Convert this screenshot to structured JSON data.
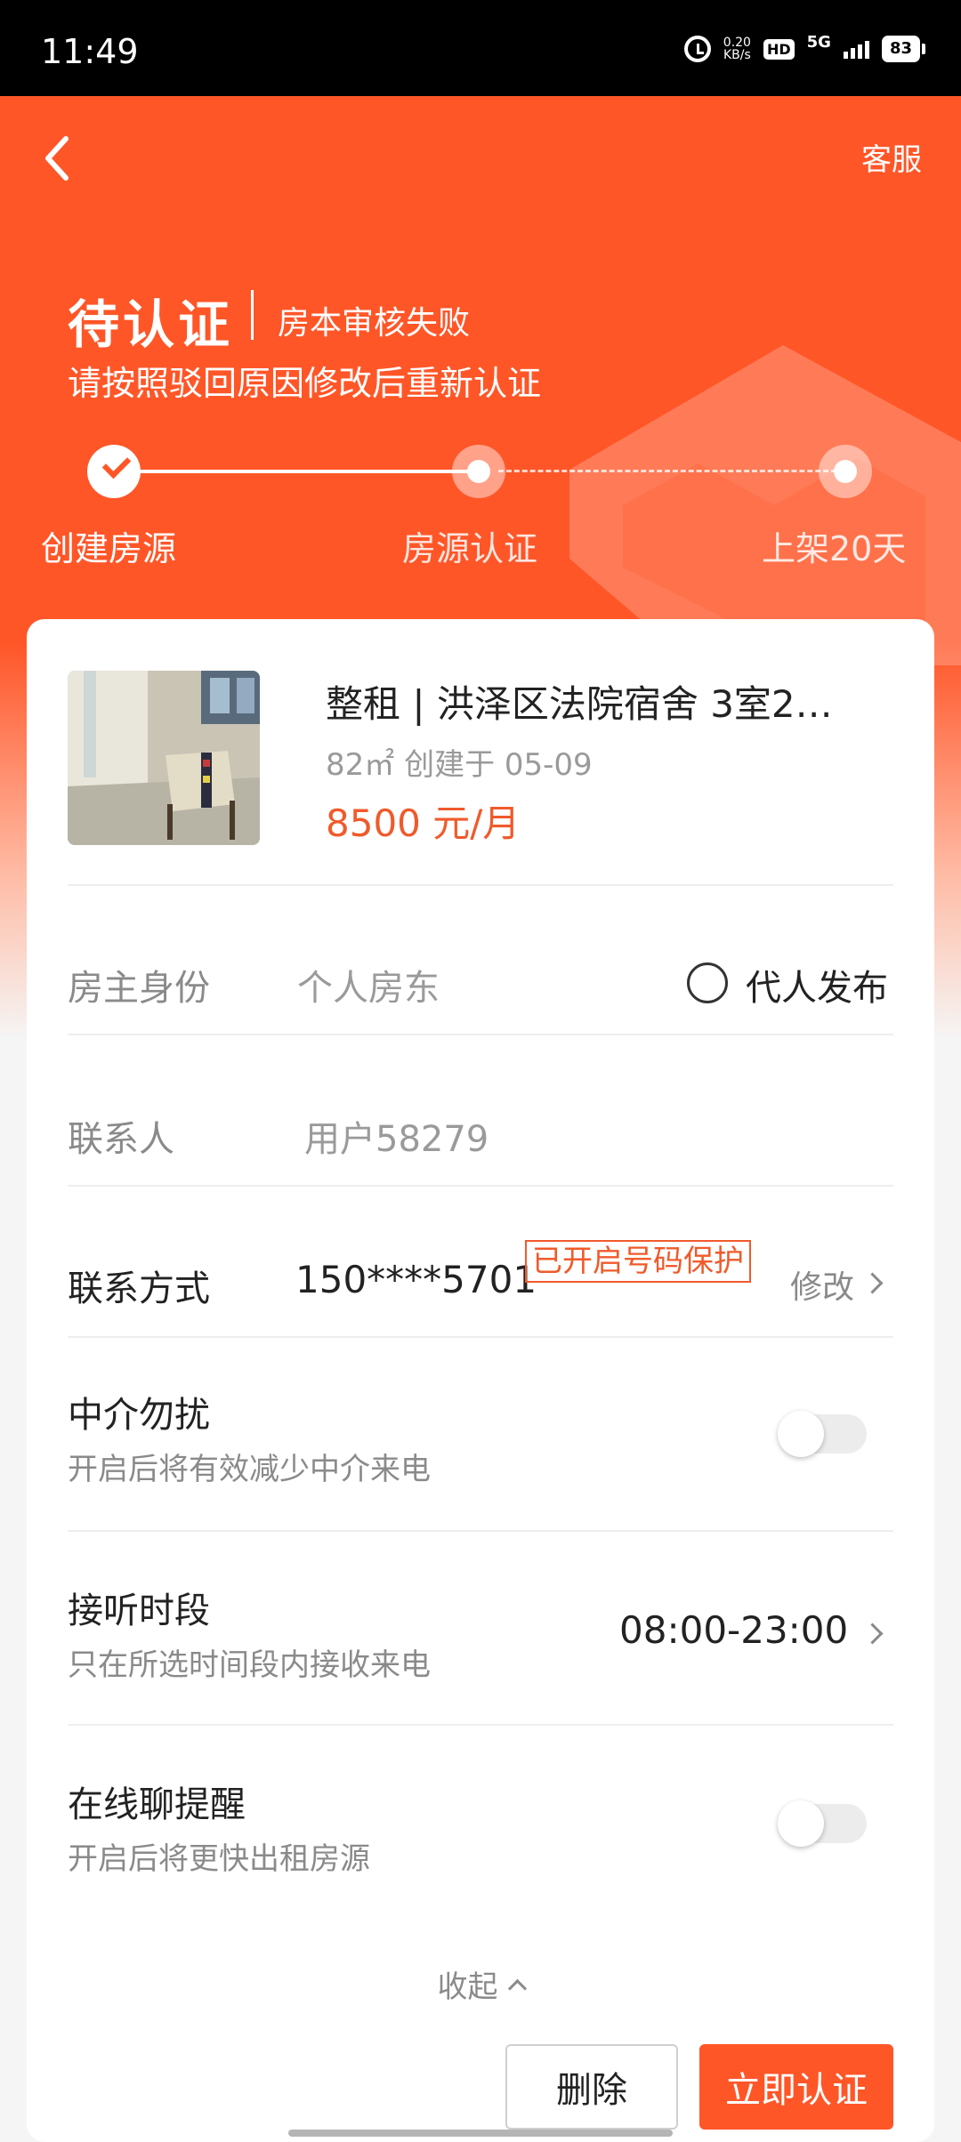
{
  "status_bar": {
    "time": "11:49",
    "net_speed_top": "0.20",
    "net_speed_bottom": "KB/s",
    "hd": "HD",
    "network": "5G",
    "battery": "83"
  },
  "header": {
    "back_icon": "back-arrow-icon",
    "service_label": "客服",
    "status_title": "待认证",
    "status_sub": "房本审核失败",
    "hint": "请按照驳回原因修改后重新认证",
    "steps": [
      {
        "label": "创建房源",
        "state": "done"
      },
      {
        "label": "房源认证",
        "state": "current"
      },
      {
        "label": "上架20天",
        "state": "pending"
      }
    ]
  },
  "listing": {
    "title": "整租 | 洪泽区法院宿舍 3室2…",
    "area": "82㎡",
    "created": "创建于 05-09",
    "price": "8500 元/月"
  },
  "form": {
    "owner_label": "房主身份",
    "owner_value": "个人房东",
    "proxy_label": "代人发布",
    "contact_label": "联系人",
    "contact_value": "用户58279",
    "phone_label": "联系方式",
    "phone_value": "150****5701",
    "protect_badge": "已开启号码保护",
    "modify_label": "修改",
    "no_agent_label": "中介勿扰",
    "no_agent_sub": "开启后将有效减少中介来电",
    "answer_time_label": "接听时段",
    "answer_time_sub": "只在所选时间段内接收来电",
    "answer_time_value": "08:00-23:00",
    "online_chat_label": "在线聊提醒",
    "online_chat_sub": "开启后将更快出租房源"
  },
  "collapse_label": "收起",
  "actions": {
    "delete_label": "删除",
    "verify_label": "立即认证"
  },
  "colors": {
    "accent": "#ff5628",
    "price": "#f05a2b"
  }
}
